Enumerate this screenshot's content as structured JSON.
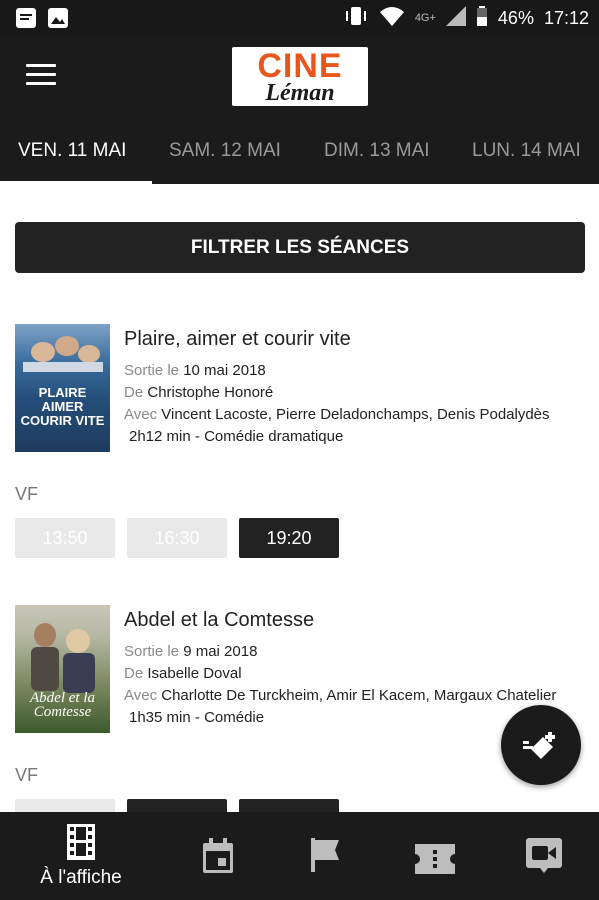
{
  "status_bar": {
    "network": "4G+",
    "battery": "46%",
    "time": "17:12",
    "left_icons": [
      "message-icon",
      "image-icon"
    ],
    "right_icons": [
      "vibrate-icon",
      "wifi-icon",
      "signal-icon",
      "battery-icon"
    ]
  },
  "header": {
    "logo_top": "CINE",
    "logo_bottom": "Léman",
    "menu_icon": "hamburger-icon"
  },
  "tabs": [
    {
      "label": "VEN. 11 MAI",
      "active": true
    },
    {
      "label": "SAM. 12 MAI",
      "active": false
    },
    {
      "label": "DIM. 13 MAI",
      "active": false
    },
    {
      "label": "LUN. 14 MAI",
      "active": false
    }
  ],
  "filter": {
    "label": "FILTRER LES SÉANCES"
  },
  "movies": [
    {
      "title": "Plaire, aimer et courir vite",
      "poster_title": "PLAIRE AIMER COURIR VITE",
      "release_label": "Sortie le",
      "release_date": "10 mai 2018",
      "director_label": "De",
      "director": "Christophe Honoré",
      "cast_label": "Avec",
      "cast": "Vincent Lacoste, Pierre Deladonchamps, Denis Podalydès",
      "duration": "2h12 min",
      "separator": "-",
      "genre": "Comédie dramatique",
      "version": "VF",
      "showtimes": [
        {
          "time": "13:50",
          "state": "past"
        },
        {
          "time": "16:30",
          "state": "past"
        },
        {
          "time": "19:20",
          "state": "available"
        }
      ]
    },
    {
      "title": "Abdel et la Comtesse",
      "poster_title": "Abdel et la Comtesse",
      "release_label": "Sortie le",
      "release_date": "9 mai 2018",
      "director_label": "De",
      "director": "Isabelle Doval",
      "cast_label": "Avec",
      "cast": "Charlotte De Turckheim, Amir El Kacem, Margaux Chatelier",
      "duration": "1h35 min",
      "separator": "-",
      "genre": "Comédie",
      "version": "VF",
      "showtimes": []
    }
  ],
  "fab": {
    "icon": "ticket-add-icon"
  },
  "bottom_nav": [
    {
      "icon": "film-icon",
      "label": "À l'affiche",
      "active": true
    },
    {
      "icon": "calendar-icon",
      "label": "",
      "active": false
    },
    {
      "icon": "flag-icon",
      "label": "",
      "active": false
    },
    {
      "icon": "ticket-icon",
      "label": "",
      "active": false
    },
    {
      "icon": "video-icon",
      "label": "",
      "active": false
    }
  ],
  "colors": {
    "bar": "#1b1b1b",
    "logo_orange": "#e8561c",
    "active_time": "#222222",
    "past_time": "#e8e8e8"
  }
}
